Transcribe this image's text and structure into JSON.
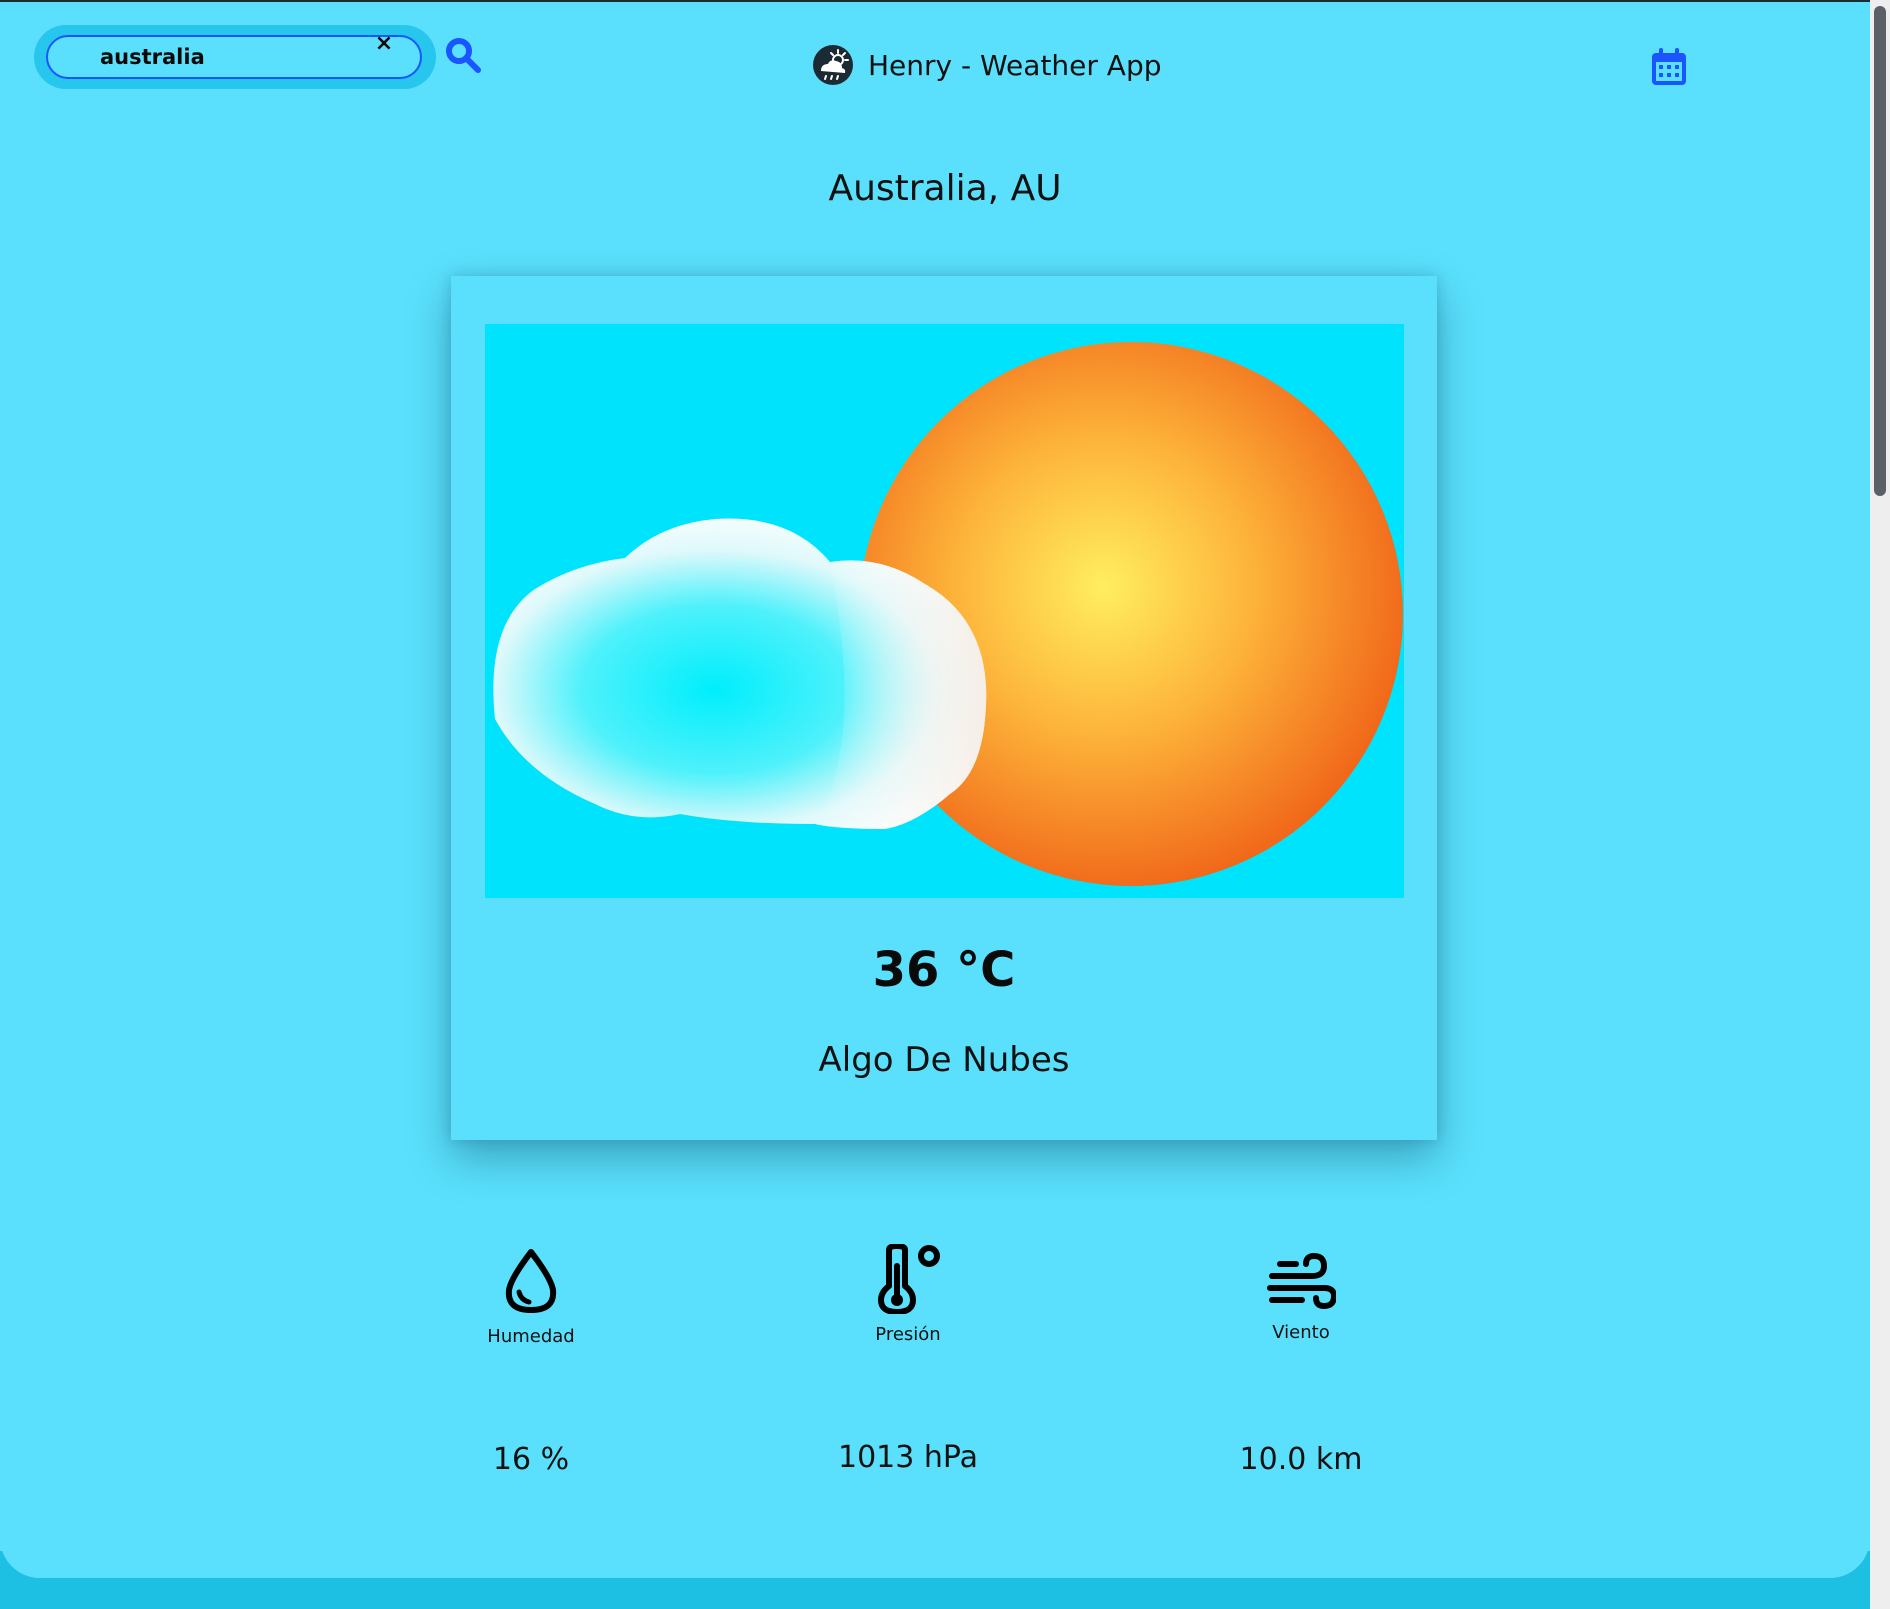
{
  "header": {
    "search": {
      "value": "australia",
      "placeholder": "",
      "clear_glyph": "×",
      "search_icon": "search-icon"
    },
    "brand": {
      "title": "Henry - Weather App",
      "logo_icon": "weather-cloud-logo-icon"
    },
    "calendar_icon": "calendar-icon"
  },
  "location": {
    "city": "Australia, AU"
  },
  "weather": {
    "temperature": "36 °C",
    "description": "Algo De Nubes",
    "image": "sun-behind-cloud-illustration"
  },
  "stats": [
    {
      "icon": "water-drop-icon",
      "label": "Humedad",
      "value": "16 %"
    },
    {
      "icon": "thermometer-icon",
      "label": "Presión",
      "value": "1013 hPa"
    },
    {
      "icon": "wind-icon",
      "label": "Viento",
      "value": "10.0 km"
    }
  ],
  "colors": {
    "background": "#5ae0fc",
    "accent": "#1b55ff",
    "image_sky": "#00e3fc",
    "sun_center": "#ffe95c",
    "sun_edge": "#f06418"
  }
}
